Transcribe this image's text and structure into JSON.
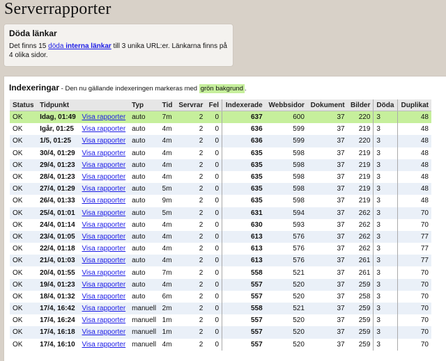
{
  "page": {
    "title": "Serverrapporter"
  },
  "dead_links": {
    "heading": "Döda länkar",
    "text_1": "Det finns 15 ",
    "link_1": "döda ",
    "link_2": "interna länkar",
    "text_2": " till 3 unika URL:er. Länkarna finns på 4 olika sidor."
  },
  "indexing": {
    "heading": "Indexeringar",
    "subtitle": " - Den nu gällande indexeringen markeras med ",
    "green_label": "grön bakgrund",
    "dot": ".",
    "columns": [
      "Status",
      "Tidpunkt",
      "",
      "Typ",
      "Tid",
      "Servrar",
      "Fel",
      "Indexerade",
      "Webbsidor",
      "Dokument",
      "Bilder",
      "Döda",
      "Duplikat"
    ],
    "rows": [
      [
        "OK",
        "Idag, 01:49",
        "Visa rapporter",
        "auto",
        "7m",
        "2",
        "0",
        "637",
        "600",
        "37",
        "220",
        "3",
        "48"
      ],
      [
        "OK",
        "Igår, 01:25",
        "Visa rapporter",
        "auto",
        "4m",
        "2",
        "0",
        "636",
        "599",
        "37",
        "219",
        "3",
        "48"
      ],
      [
        "OK",
        "1/5, 01:25",
        "Visa rapporter",
        "auto",
        "4m",
        "2",
        "0",
        "636",
        "599",
        "37",
        "220",
        "3",
        "48"
      ],
      [
        "OK",
        "30/4, 01:29",
        "Visa rapporter",
        "auto",
        "4m",
        "2",
        "0",
        "635",
        "598",
        "37",
        "219",
        "3",
        "48"
      ],
      [
        "OK",
        "29/4, 01:23",
        "Visa rapporter",
        "auto",
        "4m",
        "2",
        "0",
        "635",
        "598",
        "37",
        "219",
        "3",
        "48"
      ],
      [
        "OK",
        "28/4, 01:23",
        "Visa rapporter",
        "auto",
        "4m",
        "2",
        "0",
        "635",
        "598",
        "37",
        "219",
        "3",
        "48"
      ],
      [
        "OK",
        "27/4, 01:29",
        "Visa rapporter",
        "auto",
        "5m",
        "2",
        "0",
        "635",
        "598",
        "37",
        "219",
        "3",
        "48"
      ],
      [
        "OK",
        "26/4, 01:33",
        "Visa rapporter",
        "auto",
        "9m",
        "2",
        "0",
        "635",
        "598",
        "37",
        "219",
        "3",
        "48"
      ],
      [
        "OK",
        "25/4, 01:01",
        "Visa rapporter",
        "auto",
        "5m",
        "2",
        "0",
        "631",
        "594",
        "37",
        "262",
        "3",
        "70"
      ],
      [
        "OK",
        "24/4, 01:14",
        "Visa rapporter",
        "auto",
        "4m",
        "2",
        "0",
        "630",
        "593",
        "37",
        "262",
        "3",
        "70"
      ],
      [
        "OK",
        "23/4, 01:05",
        "Visa rapporter",
        "auto",
        "4m",
        "2",
        "0",
        "613",
        "576",
        "37",
        "262",
        "3",
        "77"
      ],
      [
        "OK",
        "22/4, 01:18",
        "Visa rapporter",
        "auto",
        "4m",
        "2",
        "0",
        "613",
        "576",
        "37",
        "262",
        "3",
        "77"
      ],
      [
        "OK",
        "21/4, 01:03",
        "Visa rapporter",
        "auto",
        "4m",
        "2",
        "0",
        "613",
        "576",
        "37",
        "261",
        "3",
        "77"
      ],
      [
        "OK",
        "20/4, 01:55",
        "Visa rapporter",
        "auto",
        "7m",
        "2",
        "0",
        "558",
        "521",
        "37",
        "261",
        "3",
        "70"
      ],
      [
        "OK",
        "19/4, 01:23",
        "Visa rapporter",
        "auto",
        "4m",
        "2",
        "0",
        "557",
        "520",
        "37",
        "259",
        "3",
        "70"
      ],
      [
        "OK",
        "18/4, 01:32",
        "Visa rapporter",
        "auto",
        "6m",
        "2",
        "0",
        "557",
        "520",
        "37",
        "258",
        "3",
        "70"
      ],
      [
        "OK",
        "17/4, 16:42",
        "Visa rapporter",
        "manuell",
        "2m",
        "2",
        "0",
        "558",
        "521",
        "37",
        "259",
        "3",
        "70"
      ],
      [
        "OK",
        "17/4, 16:24",
        "Visa rapporter",
        "manuell",
        "1m",
        "2",
        "0",
        "557",
        "520",
        "37",
        "259",
        "3",
        "70"
      ],
      [
        "OK",
        "17/4, 16:18",
        "Visa rapporter",
        "manuell",
        "1m",
        "2",
        "0",
        "557",
        "520",
        "37",
        "259",
        "3",
        "70"
      ],
      [
        "OK",
        "17/4, 16:10",
        "Visa rapporter",
        "manuell",
        "4m",
        "2",
        "0",
        "557",
        "520",
        "37",
        "259",
        "3",
        "70"
      ]
    ]
  }
}
